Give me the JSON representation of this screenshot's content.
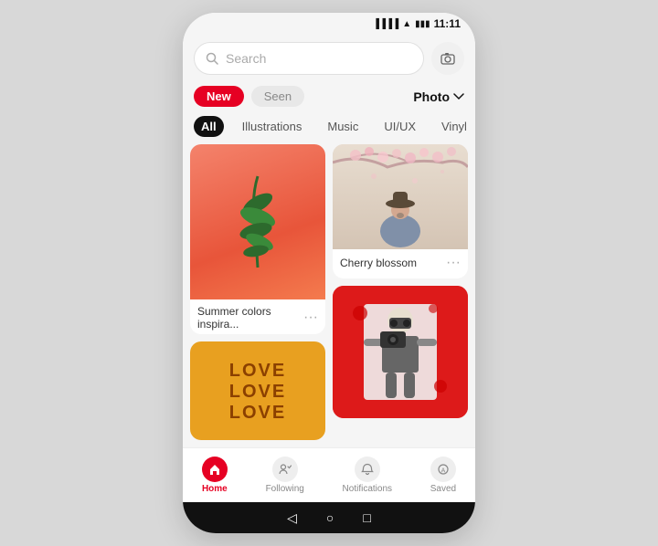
{
  "status": {
    "time": "11:11"
  },
  "search": {
    "placeholder": "Search"
  },
  "tabs1": {
    "new_label": "New",
    "seen_label": "Seen",
    "photo_label": "Photo"
  },
  "tabs2": {
    "categories": [
      "All",
      "Illustrations",
      "Music",
      "UI/UX",
      "Vinyl"
    ]
  },
  "pins": [
    {
      "id": "summer",
      "label": "Summer colors inspira...",
      "col": 0
    },
    {
      "id": "love",
      "label": "",
      "col": 0
    },
    {
      "id": "cherry",
      "label": "Cherry blossom",
      "col": 1
    },
    {
      "id": "graffiti",
      "label": "",
      "col": 1
    }
  ],
  "love_lines": [
    "LOVE",
    "LOVE",
    "LOVE"
  ],
  "nav": {
    "items": [
      {
        "label": "Home",
        "active": true
      },
      {
        "label": "Following",
        "active": false
      },
      {
        "label": "Notifications",
        "active": false
      },
      {
        "label": "Saved",
        "active": false
      }
    ]
  },
  "android_nav": {
    "back": "◁",
    "home": "○",
    "recents": "□"
  }
}
